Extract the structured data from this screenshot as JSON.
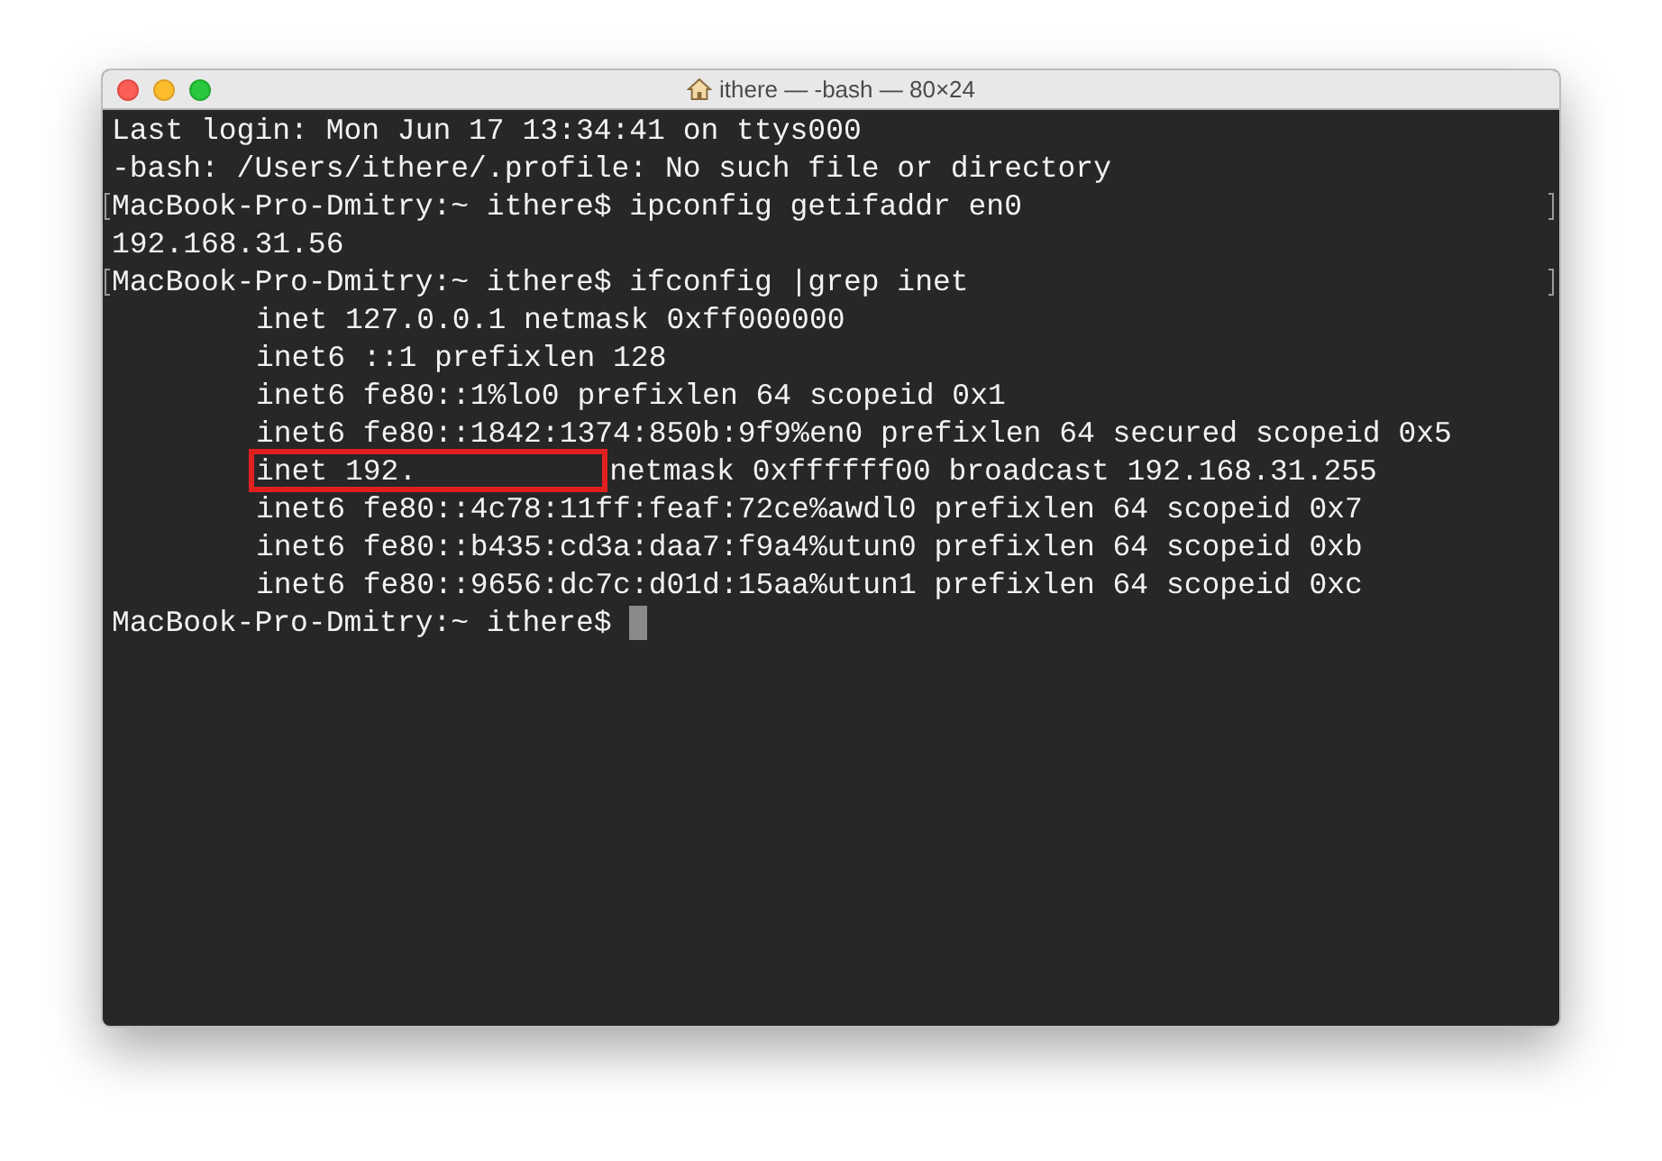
{
  "window": {
    "title": "ithere — -bash — 80×24"
  },
  "lines": [
    {
      "kind": "output",
      "text": "Last login: Mon Jun 17 13:34:41 on ttys000",
      "marked": false
    },
    {
      "kind": "output",
      "text": "-bash: /Users/ithere/.profile: No such file or directory",
      "marked": false
    },
    {
      "kind": "output",
      "text": "MacBook-Pro-Dmitry:~ ithere$ ipconfig getifaddr en0",
      "marked": true
    },
    {
      "kind": "output",
      "text": "192.168.31.56",
      "marked": false
    },
    {
      "kind": "output",
      "text": "MacBook-Pro-Dmitry:~ ithere$ ifconfig |grep inet",
      "marked": true
    },
    {
      "kind": "indented",
      "text": "inet 127.0.0.1 netmask 0xff000000",
      "marked": false
    },
    {
      "kind": "indented",
      "text": "inet6 ::1 prefixlen 128",
      "marked": false
    },
    {
      "kind": "indented",
      "text": "inet6 fe80::1%lo0 prefixlen 64 scopeid 0x1",
      "marked": false
    },
    {
      "kind": "indented",
      "text": "inet6 fe80::1842:1374:850b:9f9%en0 prefixlen 64 secured scopeid 0x5",
      "marked": false
    },
    {
      "kind": "redacted",
      "text": "inet 192.",
      "rest": "netmask 0xffffff00 broadcast 192.168.31.255",
      "marked": false
    },
    {
      "kind": "indented",
      "text": "inet6 fe80::4c78:11ff:feaf:72ce%awdl0 prefixlen 64 scopeid 0x7",
      "marked": false
    },
    {
      "kind": "indented",
      "text": "inet6 fe80::b435:cd3a:daa7:f9a4%utun0 prefixlen 64 scopeid 0xb",
      "marked": false
    },
    {
      "kind": "indented",
      "text": "inet6 fe80::9656:dc7c:d01d:15aa%utun1 prefixlen 64 scopeid 0xc",
      "marked": false
    },
    {
      "kind": "prompt",
      "text": "MacBook-Pro-Dmitry:~ ithere$",
      "marked": false
    }
  ]
}
